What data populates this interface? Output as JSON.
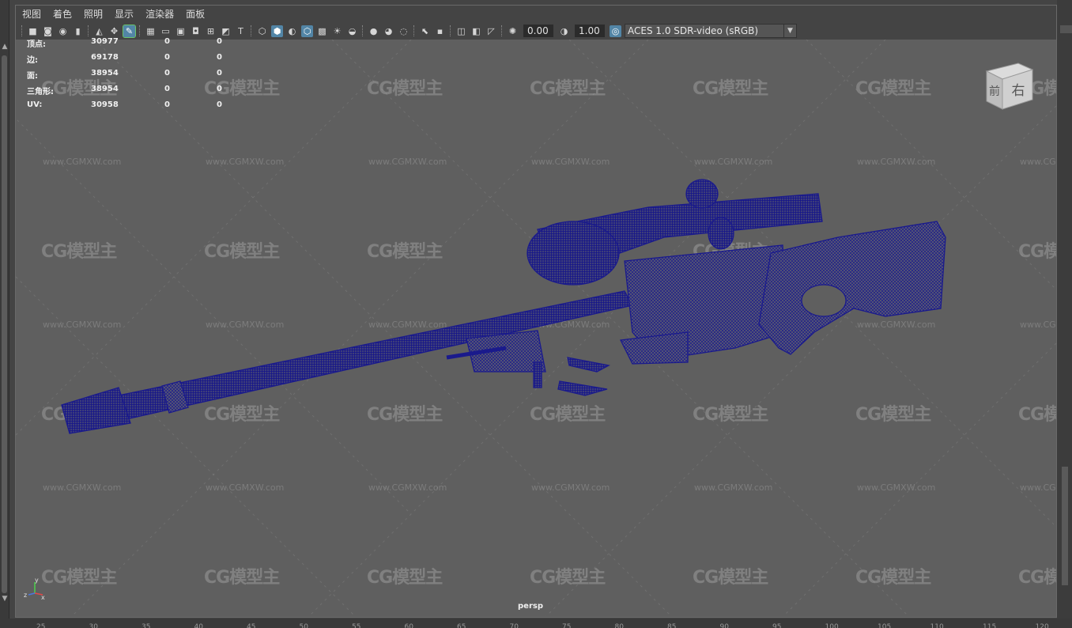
{
  "menu": [
    "视图",
    "着色",
    "照明",
    "显示",
    "渲染器",
    "面板"
  ],
  "toolbar": {
    "icons": [
      "camera-icon",
      "camera-attr-icon",
      "bookmark-icon",
      "image-plane-icon",
      "select-camera-icon",
      "film-gate-icon",
      "grease-pencil-icon",
      "grid-icon",
      "film-gate-toggle-icon",
      "resolution-gate-icon",
      "gate-mask-icon",
      "field-chart-icon",
      "safe-action-icon",
      "safe-title-icon",
      "wireframe-icon",
      "smooth-shade-icon",
      "default-material-icon",
      "wireframe-on-shaded-icon",
      "xray-icon",
      "use-lights-icon",
      "shadows-icon",
      "screen-ao-icon",
      "motion-blur-icon",
      "anti-alias-icon",
      "depth-of-field-icon",
      "isolate-select-icon",
      "xray-joints-icon",
      "xray-active-icon",
      "backface-icon",
      "exposure-icon",
      "gamma-icon",
      "color-management-icon"
    ],
    "exposure_value": "0.00",
    "gamma_value": "1.00",
    "colorspace": "ACES 1.0 SDR-video (sRGB)"
  },
  "hud": {
    "rows": [
      {
        "label": "顶点:",
        "c1": "30977",
        "c2": "0",
        "c3": "0"
      },
      {
        "label": "边:",
        "c1": "69178",
        "c2": "0",
        "c3": "0"
      },
      {
        "label": "面:",
        "c1": "38954",
        "c2": "0",
        "c3": "0"
      },
      {
        "label": "三角形:",
        "c1": "38954",
        "c2": "0",
        "c3": "0"
      },
      {
        "label": "UV:",
        "c1": "30958",
        "c2": "0",
        "c3": "0"
      }
    ]
  },
  "watermark": {
    "logo": "CG模型主",
    "url": "www.CGMXW.com"
  },
  "viewcube": {
    "front": "前",
    "right": "右"
  },
  "axis": {
    "x": "x",
    "y": "y",
    "z": "z"
  },
  "camera_label": "persp",
  "timeline_ticks": [
    "25",
    "30",
    "35",
    "40",
    "45",
    "50",
    "55",
    "60",
    "65",
    "70",
    "75",
    "80",
    "85",
    "90",
    "95",
    "100",
    "105",
    "110",
    "115",
    "120"
  ],
  "colors": {
    "viewport_bg": "#5f5f5f",
    "wireframe": "#1a1a8c",
    "active_icon": "#5285a6"
  }
}
